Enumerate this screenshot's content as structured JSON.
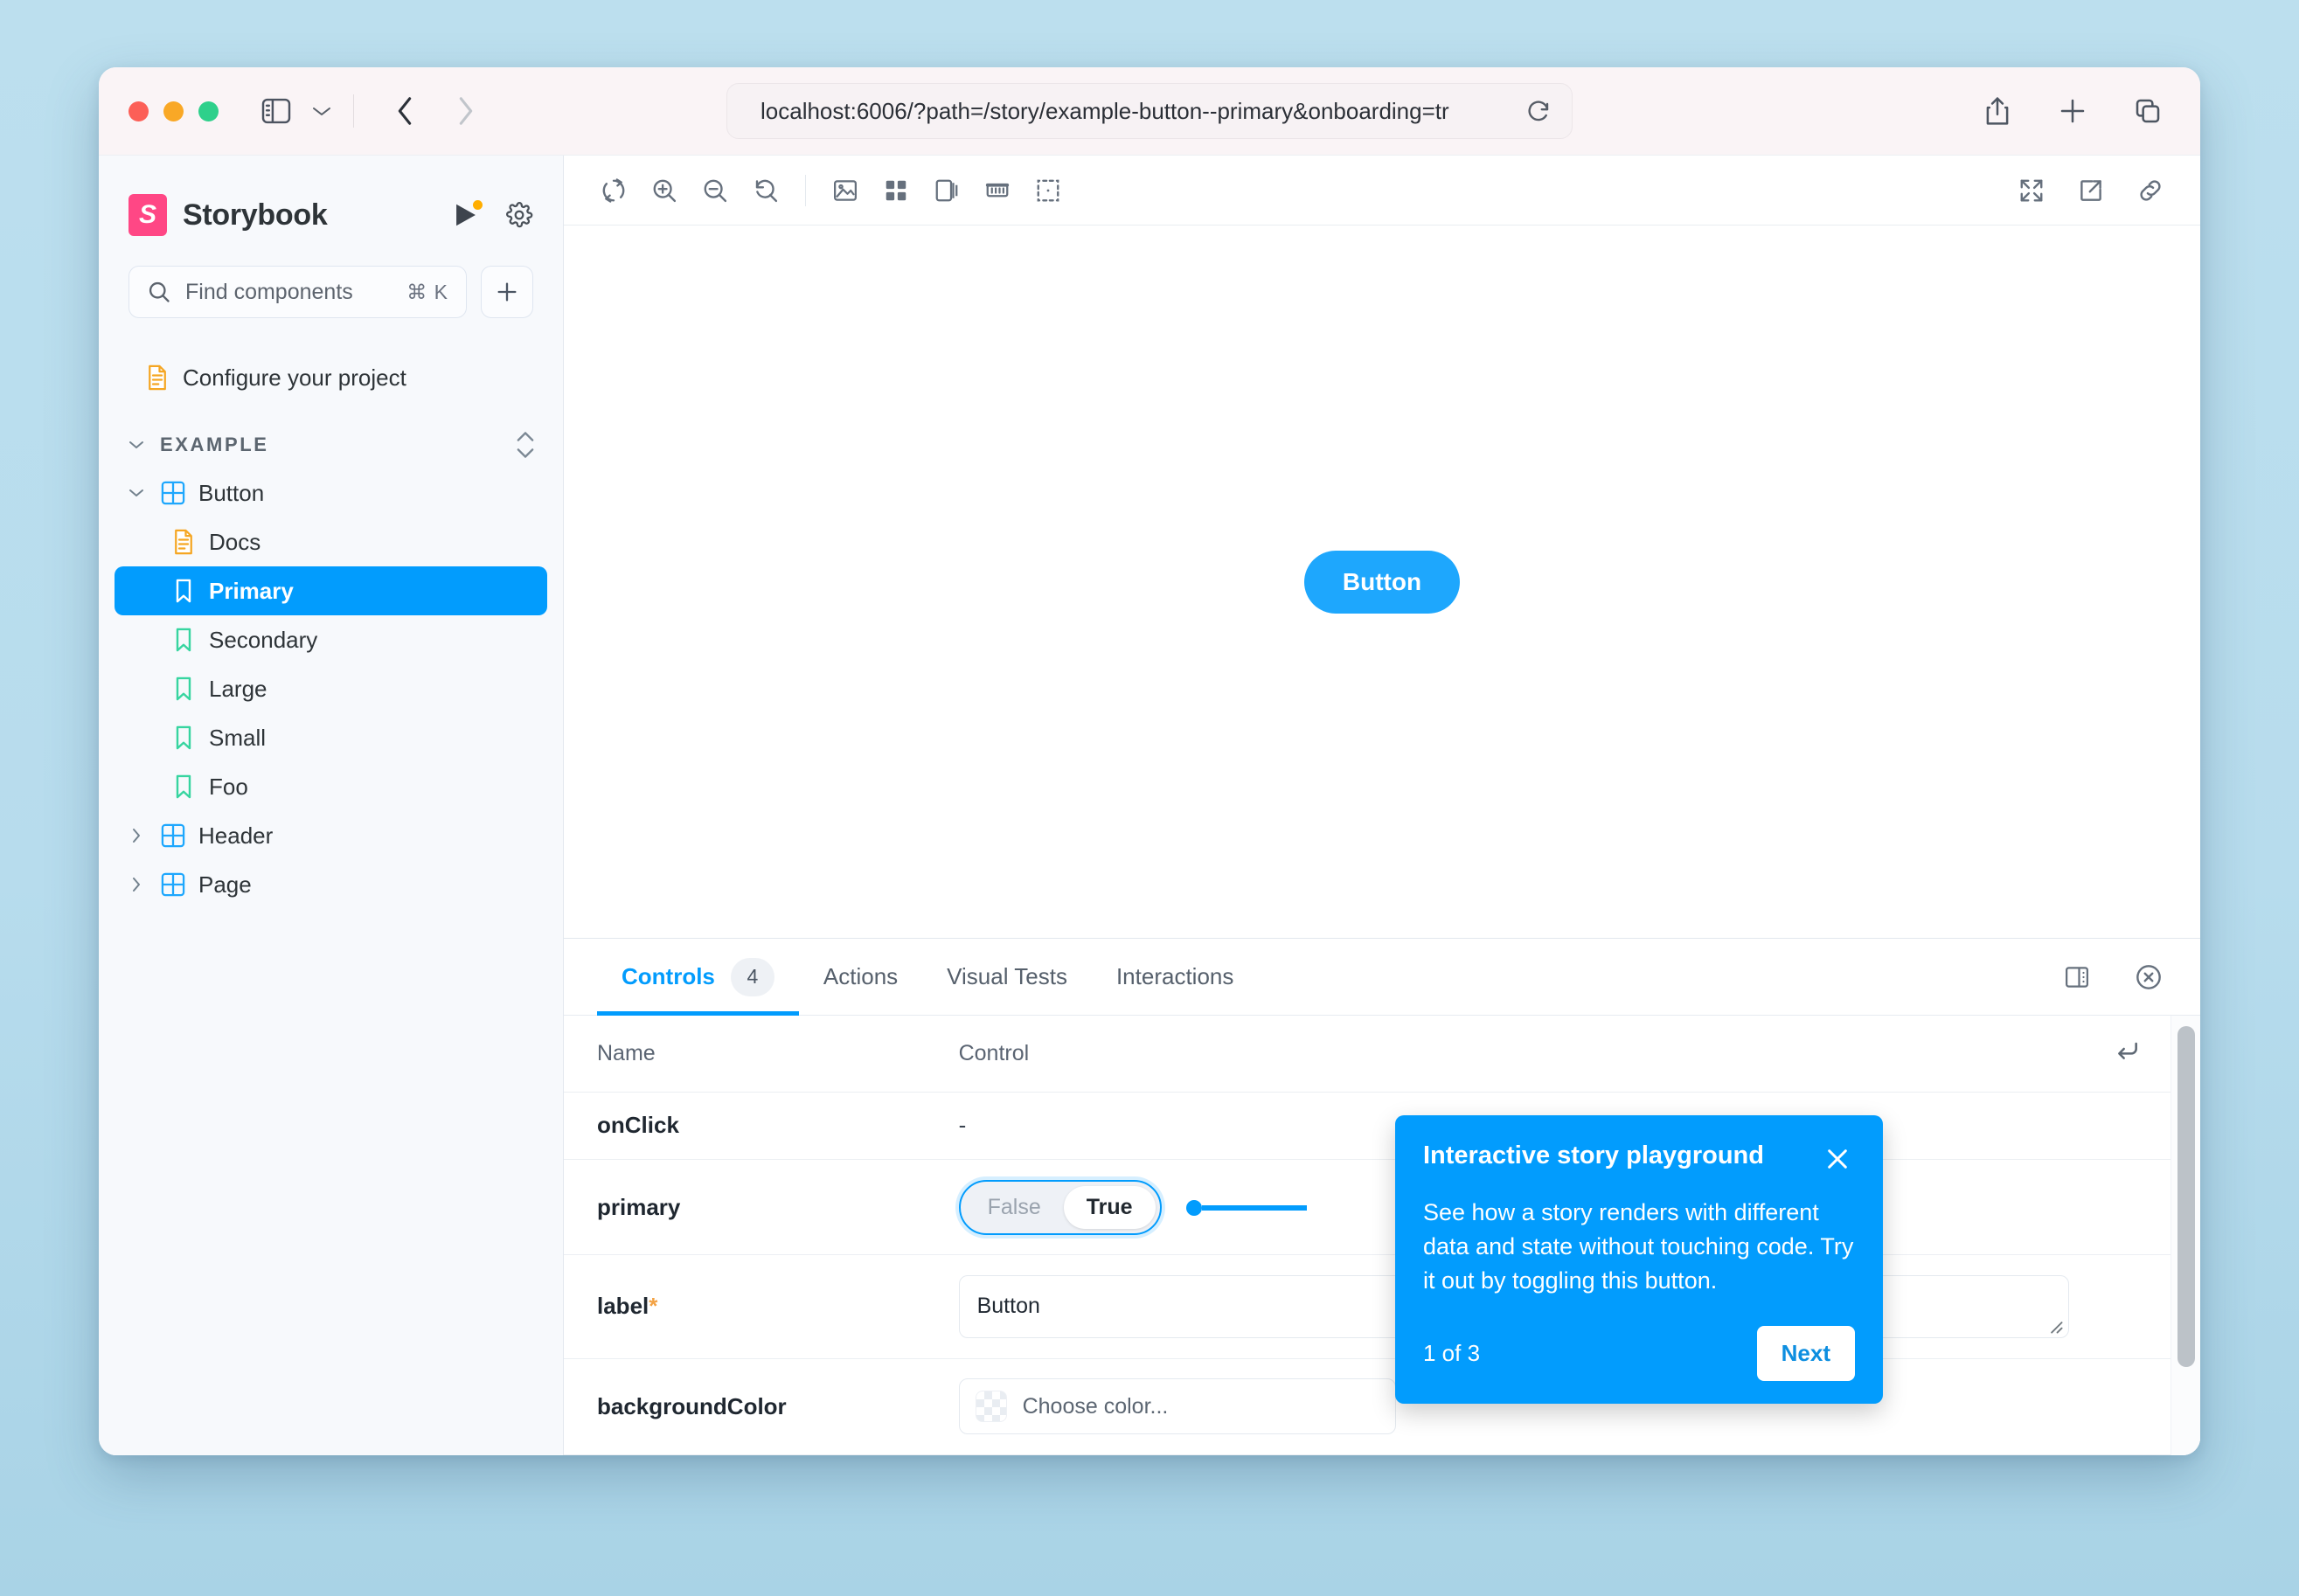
{
  "browser": {
    "url": "localhost:6006/?path=/story/example-button--primary&onboarding=tr",
    "traffic": {
      "close": "close-window",
      "minimize": "minimize-window",
      "zoom": "zoom-window"
    },
    "toolbar": {
      "sidebar_toggle": "sidebar-toggle",
      "sidebar_menu": "sidebar-menu-chevron",
      "back": "back",
      "forward": "forward",
      "reload": "reload",
      "share": "share",
      "new_tab": "new-tab",
      "tab_overview": "tab-overview"
    }
  },
  "sidebar": {
    "brand": "Storybook",
    "brand_mark": "S",
    "actions": {
      "shortcuts": "play-with-updates",
      "settings": "settings"
    },
    "search": {
      "placeholder": "Find components",
      "shortcut": "⌘ K",
      "add": "+"
    },
    "configure": {
      "label": "Configure your project",
      "icon": "document-icon"
    },
    "group": {
      "label": "EXAMPLE",
      "sort": "sort-stories"
    },
    "tree": [
      {
        "label": "Button",
        "icon": "component-icon",
        "level": 0,
        "expanded": true,
        "selected": false
      },
      {
        "label": "Docs",
        "icon": "document-icon",
        "level": 1,
        "expanded": null,
        "selected": false
      },
      {
        "label": "Primary",
        "icon": "story-icon",
        "level": 1,
        "expanded": null,
        "selected": true
      },
      {
        "label": "Secondary",
        "icon": "story-icon",
        "level": 1,
        "expanded": null,
        "selected": false
      },
      {
        "label": "Large",
        "icon": "story-icon",
        "level": 1,
        "expanded": null,
        "selected": false
      },
      {
        "label": "Small",
        "icon": "story-icon",
        "level": 1,
        "expanded": null,
        "selected": false
      },
      {
        "label": "Foo",
        "icon": "story-icon",
        "level": 1,
        "expanded": null,
        "selected": false
      },
      {
        "label": "Header",
        "icon": "component-icon",
        "level": 0,
        "expanded": false,
        "selected": false
      },
      {
        "label": "Page",
        "icon": "component-icon",
        "level": 0,
        "expanded": false,
        "selected": false
      }
    ]
  },
  "canvas": {
    "toolbar_left": [
      "remount-icon",
      "zoom-in-icon",
      "zoom-out-icon",
      "zoom-reset-icon",
      "backgrounds-icon",
      "grid-icon",
      "viewport-icon",
      "measure-icon",
      "outline-icon"
    ],
    "toolbar_right": [
      "fullscreen-icon",
      "open-new-tab-icon",
      "copy-link-icon"
    ],
    "story_button_label": "Button",
    "story_button_color": "#1ea7fd"
  },
  "panel": {
    "tabs": [
      {
        "label": "Controls",
        "badge": "4",
        "active": true
      },
      {
        "label": "Actions",
        "badge": "",
        "active": false
      },
      {
        "label": "Visual Tests",
        "badge": "",
        "active": false
      },
      {
        "label": "Interactions",
        "badge": "",
        "active": false
      }
    ],
    "actions": {
      "layout": "panel-position-icon",
      "close": "close-panel-icon"
    },
    "columns": {
      "name": "Name",
      "control": "Control"
    },
    "reset_icon": "reset-controls-icon",
    "rows": [
      {
        "name": "onClick",
        "required": false,
        "control_type": "none",
        "value": "-"
      },
      {
        "name": "primary",
        "required": false,
        "control_type": "boolean",
        "options": [
          "False",
          "True"
        ],
        "value": "True"
      },
      {
        "name": "label",
        "required": true,
        "control_type": "textarea",
        "value": "Button"
      },
      {
        "name": "backgroundColor",
        "required": false,
        "control_type": "color",
        "placeholder": "Choose color...",
        "value": ""
      }
    ]
  },
  "tour": {
    "title": "Interactive story playground",
    "body": "See how a story renders with different data and state without touching code. Try it out by toggling this button.",
    "step": "1 of 3",
    "next_label": "Next",
    "close": "close-tour",
    "accent": "#029cfd"
  }
}
